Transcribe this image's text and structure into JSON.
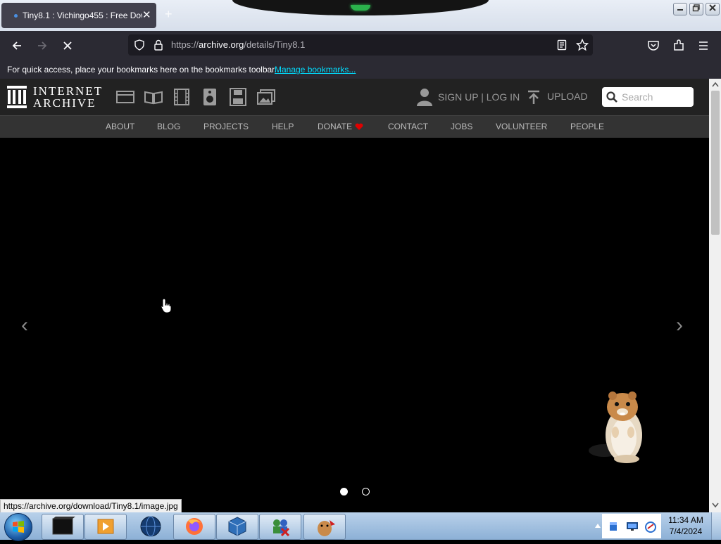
{
  "browser": {
    "tab_title": "Tiny8.1 : Vichingo455 : Free Dow",
    "tab_close": "✕",
    "new_tab": "+",
    "url_prefix": "https://",
    "url_host": "archive.org",
    "url_path": "/details/Tiny8.1",
    "bookmarks_message": "For quick access, place your bookmarks here on the bookmarks toolbar.",
    "manage_bookmarks": "Manage bookmarks...",
    "status_url": "https://archive.org/download/Tiny8.1/image.jpg"
  },
  "ia": {
    "logo_line1": "INTERNET",
    "logo_line2": "ARCHIVE",
    "sign_up_login": "SIGN UP | LOG IN",
    "upload": "UPLOAD",
    "search_placeholder": "Search",
    "nav": [
      "ABOUT",
      "BLOG",
      "PROJECTS",
      "HELP",
      "DONATE",
      "CONTACT",
      "JOBS",
      "VOLUNTEER",
      "PEOPLE"
    ],
    "donate_heart_color": "#e00000"
  },
  "carousel": {
    "prev": "‹",
    "next": "›",
    "active_slide": 1,
    "slide_count": 2
  },
  "taskbar": {
    "time": "11:34 AM",
    "date": "7/4/2024"
  },
  "colors": {
    "firefox_toolbar": "#2b2a33",
    "ia_header": "#222222",
    "taskbar": "#8cb0d6"
  }
}
